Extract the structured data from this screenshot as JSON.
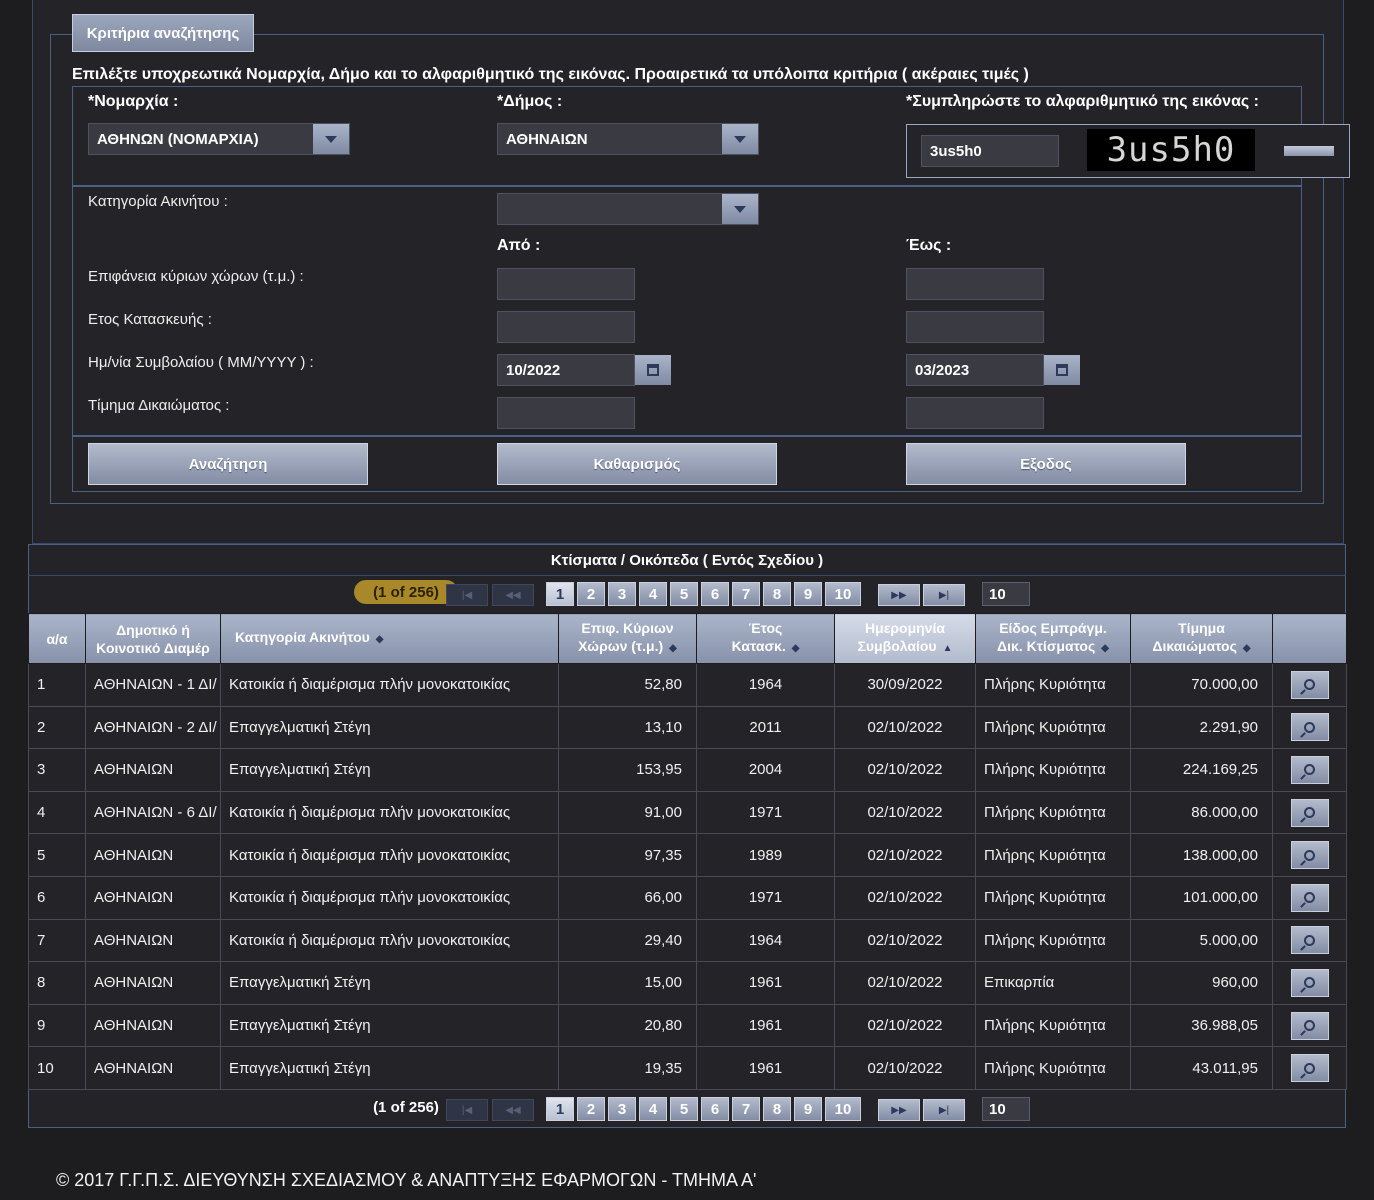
{
  "search": {
    "legend": "Κριτήρια αναζήτησης",
    "instructions": "Επιλέξτε υποχρεωτικά Νομαρχία, Δήμο και το αλφαριθμητικό της εικόνας.    Προαιρετικά τα υπόλοιπα κριτήρια ( ακέραιες τιμές )",
    "prefecture_label": "*Νομαρχία :",
    "prefecture_value": "ΑΘΗΝΩΝ (ΝΟΜΑΡΧΙΑ)",
    "municipality_label": "*Δήμος :",
    "municipality_value": "ΑΘΗΝΑΙΩΝ",
    "captcha_label": "*Συμπληρώστε το αλφαριθμητικό της εικόνας :",
    "captcha_input": "3us5h0",
    "captcha_image_text": "3us5h0",
    "category_label": "Κατηγορία Ακινήτου :",
    "category_value": "",
    "from_label": "Από :",
    "to_label": "Έως :",
    "area_label": "Επιφάνεια κύριων χώρων (τ.μ.) :",
    "year_label": "Ετος Κατασκευής :",
    "contract_date_label": "Ημ/νία Συμβολαίου ( MM/YYYY ) :",
    "contract_from": "10/2022",
    "contract_to": "03/2023",
    "price_label": "Τίμημα Δικαιώματος :",
    "search_button": "Αναζήτηση",
    "clear_button": "Καθαρισμός",
    "exit_button": "Εξοδος"
  },
  "results": {
    "title": "Κτίσματα / Οικόπεδα ( Εντός Σχεδίου )",
    "page_count": "(1 of 256)",
    "pages": [
      "1",
      "2",
      "3",
      "4",
      "5",
      "6",
      "7",
      "8",
      "9",
      "10"
    ],
    "rows_per_page": "10",
    "columns": [
      "α/α",
      "Δημοτικό ή Κοινοτικό Διαμέρ",
      "Κατηγορία Ακινήτου",
      "Επιφ. Κύριων Χώρων (τ.μ.)",
      "Έτος Κατασκ.",
      "Ημερομηνία Συμβολαίου",
      "Είδος Εμπράγμ. Δικ. Κτίσματος",
      "Τίμημα Δικαιώματος",
      ""
    ],
    "col_h1": [
      "α/α",
      "Δημοτικό ή",
      "Κατηγορία Ακινήτου",
      "Επιφ. Κύριων",
      "Έτος",
      "Ημερομηνία",
      "Είδος Εμπράγμ.",
      "Τίμημα"
    ],
    "col_h2": [
      "",
      "Κοινοτικό Διαμέρ",
      "",
      "Χώρων (τ.μ.)",
      "Κατασκ.",
      "Συμβολαίου",
      "Δικ. Κτίσματος",
      "Δικαιώματος"
    ],
    "rows": [
      [
        "1",
        "ΑΘΗΝΑΙΩΝ - 1 ΔΙ/",
        "Κατοικία ή διαμέρισμα πλήν μονοκατοικίας",
        "52,80",
        "1964",
        "30/09/2022",
        "Πλήρης Κυριότητα",
        "70.000,00"
      ],
      [
        "2",
        "ΑΘΗΝΑΙΩΝ - 2 ΔΙ/",
        "Επαγγελματική Στέγη",
        "13,10",
        "2011",
        "02/10/2022",
        "Πλήρης Κυριότητα",
        "2.291,90"
      ],
      [
        "3",
        "ΑΘΗΝΑΙΩΝ",
        "Επαγγελματική Στέγη",
        "153,95",
        "2004",
        "02/10/2022",
        "Πλήρης Κυριότητα",
        "224.169,25"
      ],
      [
        "4",
        "ΑΘΗΝΑΙΩΝ - 6 ΔΙ/",
        "Κατοικία ή διαμέρισμα πλήν μονοκατοικίας",
        "91,00",
        "1971",
        "02/10/2022",
        "Πλήρης Κυριότητα",
        "86.000,00"
      ],
      [
        "5",
        "ΑΘΗΝΑΙΩΝ",
        "Κατοικία ή διαμέρισμα πλήν μονοκατοικίας",
        "97,35",
        "1989",
        "02/10/2022",
        "Πλήρης Κυριότητα",
        "138.000,00"
      ],
      [
        "6",
        "ΑΘΗΝΑΙΩΝ",
        "Κατοικία ή διαμέρισμα πλήν μονοκατοικίας",
        "66,00",
        "1971",
        "02/10/2022",
        "Πλήρης Κυριότητα",
        "101.000,00"
      ],
      [
        "7",
        "ΑΘΗΝΑΙΩΝ",
        "Κατοικία ή διαμέρισμα πλήν μονοκατοικίας",
        "29,40",
        "1964",
        "02/10/2022",
        "Πλήρης Κυριότητα",
        "5.000,00"
      ],
      [
        "8",
        "ΑΘΗΝΑΙΩΝ",
        "Επαγγελματική Στέγη",
        "15,00",
        "1961",
        "02/10/2022",
        "Επικαρπία",
        "960,00"
      ],
      [
        "9",
        "ΑΘΗΝΑΙΩΝ",
        "Επαγγελματική Στέγη",
        "20,80",
        "1961",
        "02/10/2022",
        "Πλήρης Κυριότητα",
        "36.988,05"
      ],
      [
        "10",
        "ΑΘΗΝΑΙΩΝ",
        "Επαγγελματική Στέγη",
        "19,35",
        "1961",
        "02/10/2022",
        "Πλήρης Κυριότητα",
        "43.011,95"
      ]
    ]
  },
  "footer": "© 2017 Γ.Γ.Π.Σ. ΔΙΕΥΘΥΝΣΗ ΣΧΕΔΙΑΣΜΟΥ & ΑΝΑΠΤΥΞΗΣ ΕΦΑΡΜΟΓΩΝ - ΤΜΗΜΑ Α'",
  "icons": {
    "dropdown": "chevron-down-icon",
    "calendar": "calendar-icon",
    "refresh": "refresh-icon",
    "view": "magnifier-icon",
    "sort": "sort-icon"
  }
}
